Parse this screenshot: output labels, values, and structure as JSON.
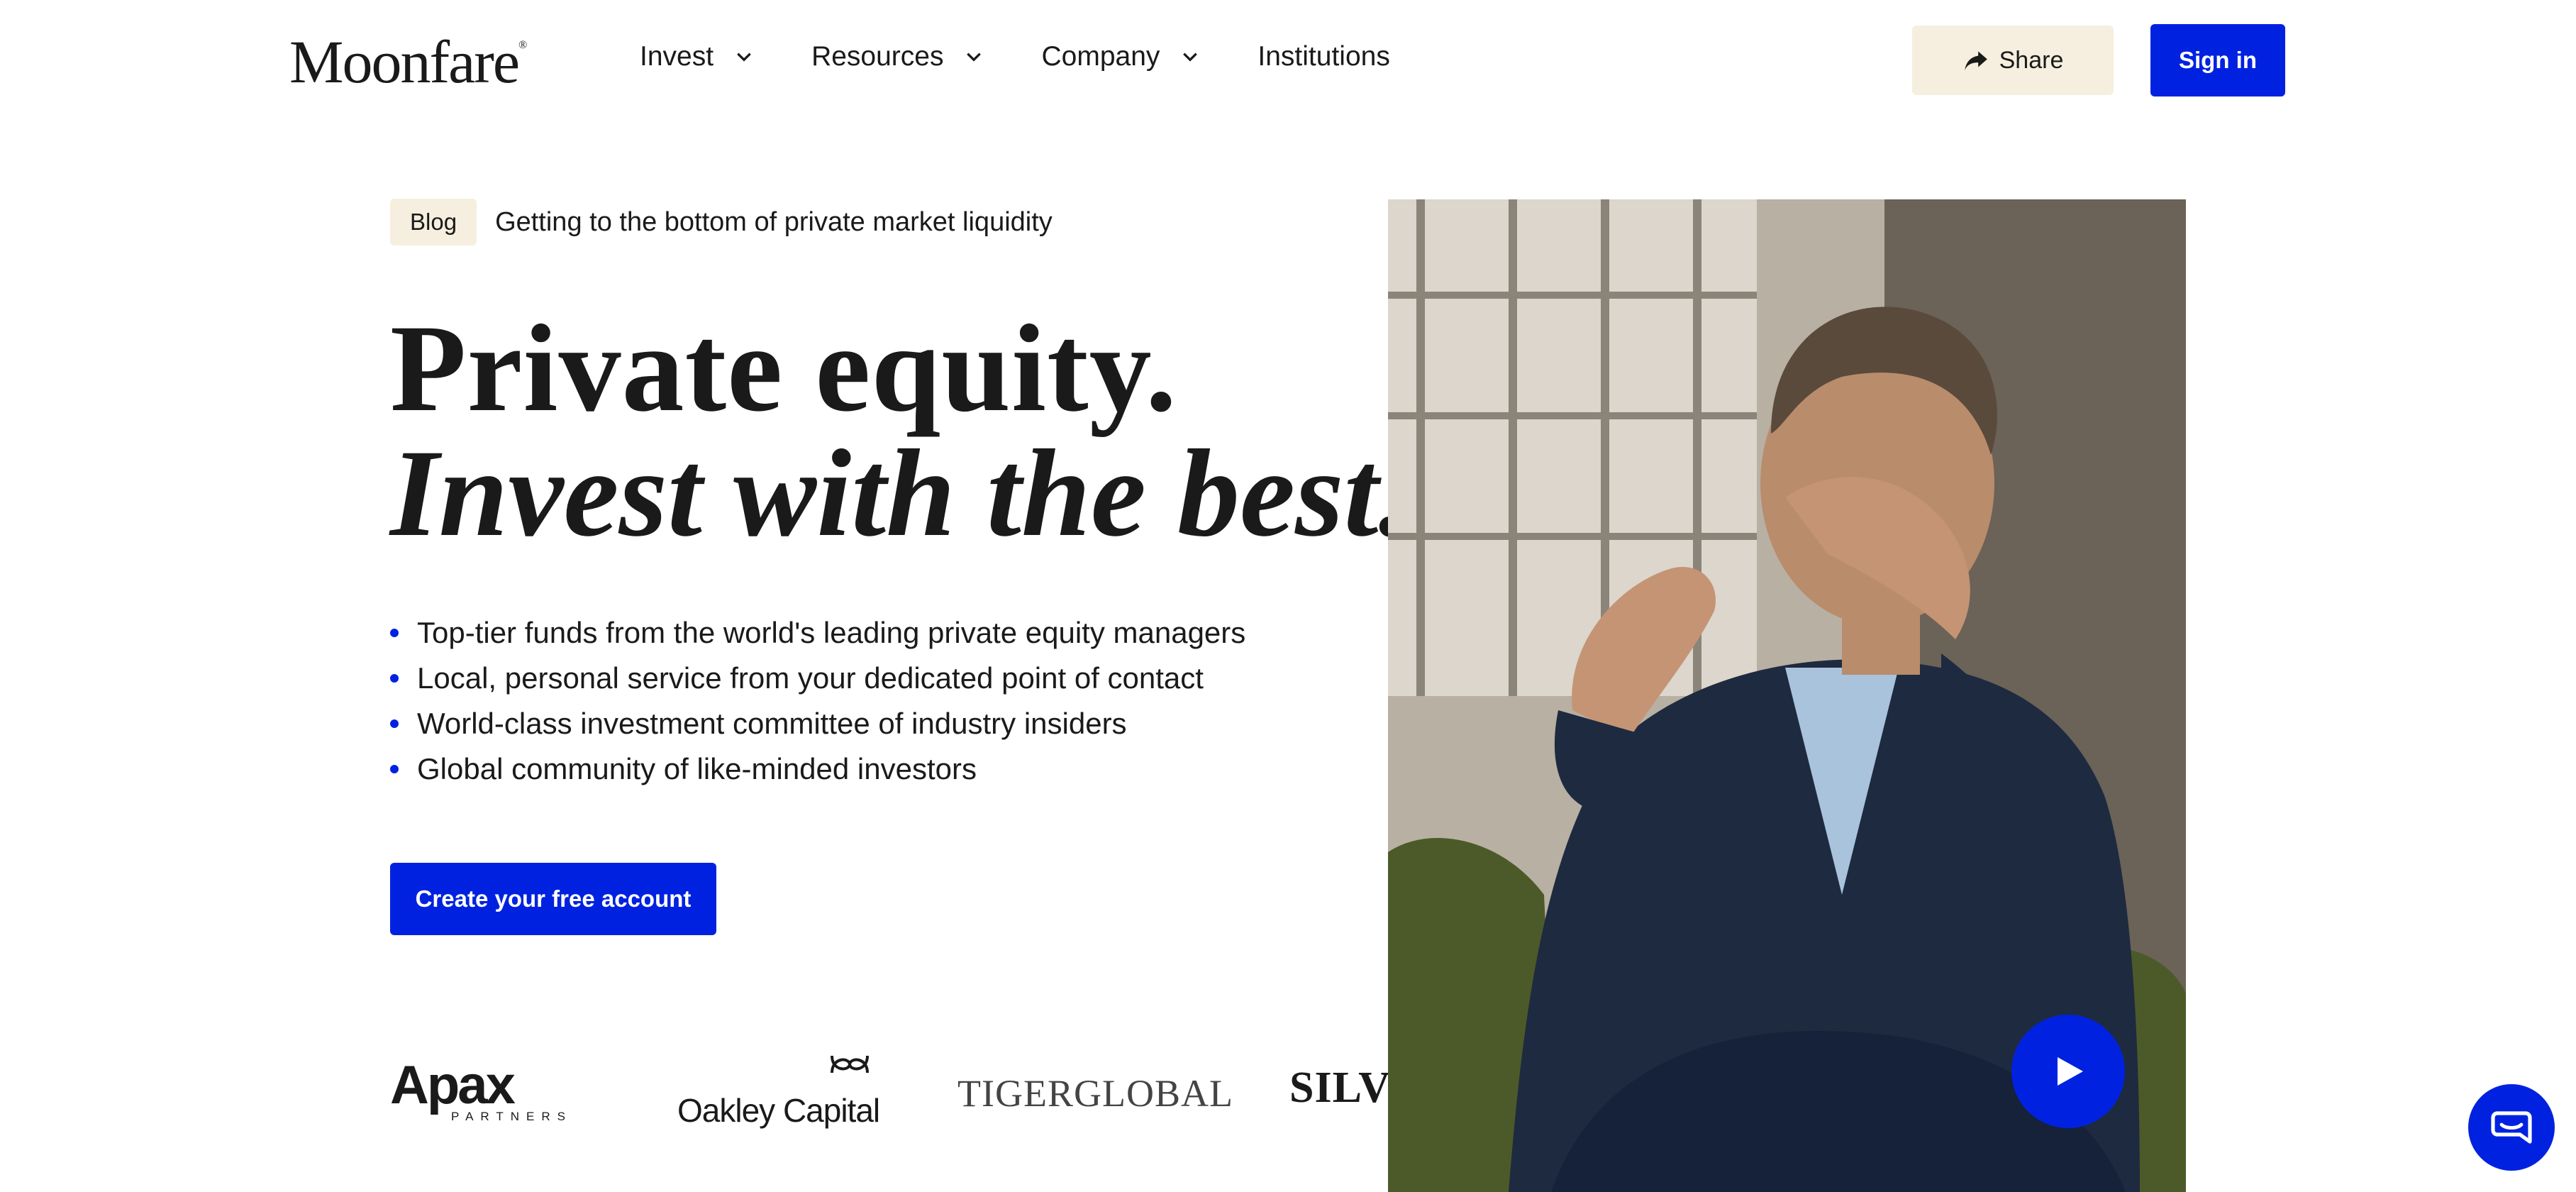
{
  "header": {
    "logo_text": "Moonfare",
    "logo_mark": "®",
    "nav": [
      {
        "label": "Invest",
        "has_dropdown": true
      },
      {
        "label": "Resources",
        "has_dropdown": true
      },
      {
        "label": "Company",
        "has_dropdown": true
      },
      {
        "label": "Institutions",
        "has_dropdown": false
      }
    ],
    "share_label": "Share",
    "signin_label": "Sign in"
  },
  "hero": {
    "tag": "Blog",
    "announcement": "Getting to the bottom of private market liquidity",
    "headline_line1": "Private equity.",
    "headline_line2": "Invest with the best.",
    "bullets": [
      "Top-tier funds from the world's leading private equity managers",
      "Local, personal service from your dedicated point of contact",
      "World-class investment committee of industry insiders",
      "Global community of like-minded investors"
    ],
    "cta_label": "Create your free account"
  },
  "partners": {
    "apax_main": "Apax",
    "apax_sub": "PARTNERS",
    "oakley": "Oakley Capital",
    "tiger": "TIGERGLOBAL",
    "silver": "SILVER"
  },
  "colors": {
    "accent": "#0022e0",
    "cream": "#f6efdf",
    "text": "#1a1a1a"
  },
  "icons": {
    "share": "share-arrow-icon",
    "chevron": "chevron-down-icon",
    "play": "play-icon",
    "chat": "chat-bubble-icon"
  }
}
